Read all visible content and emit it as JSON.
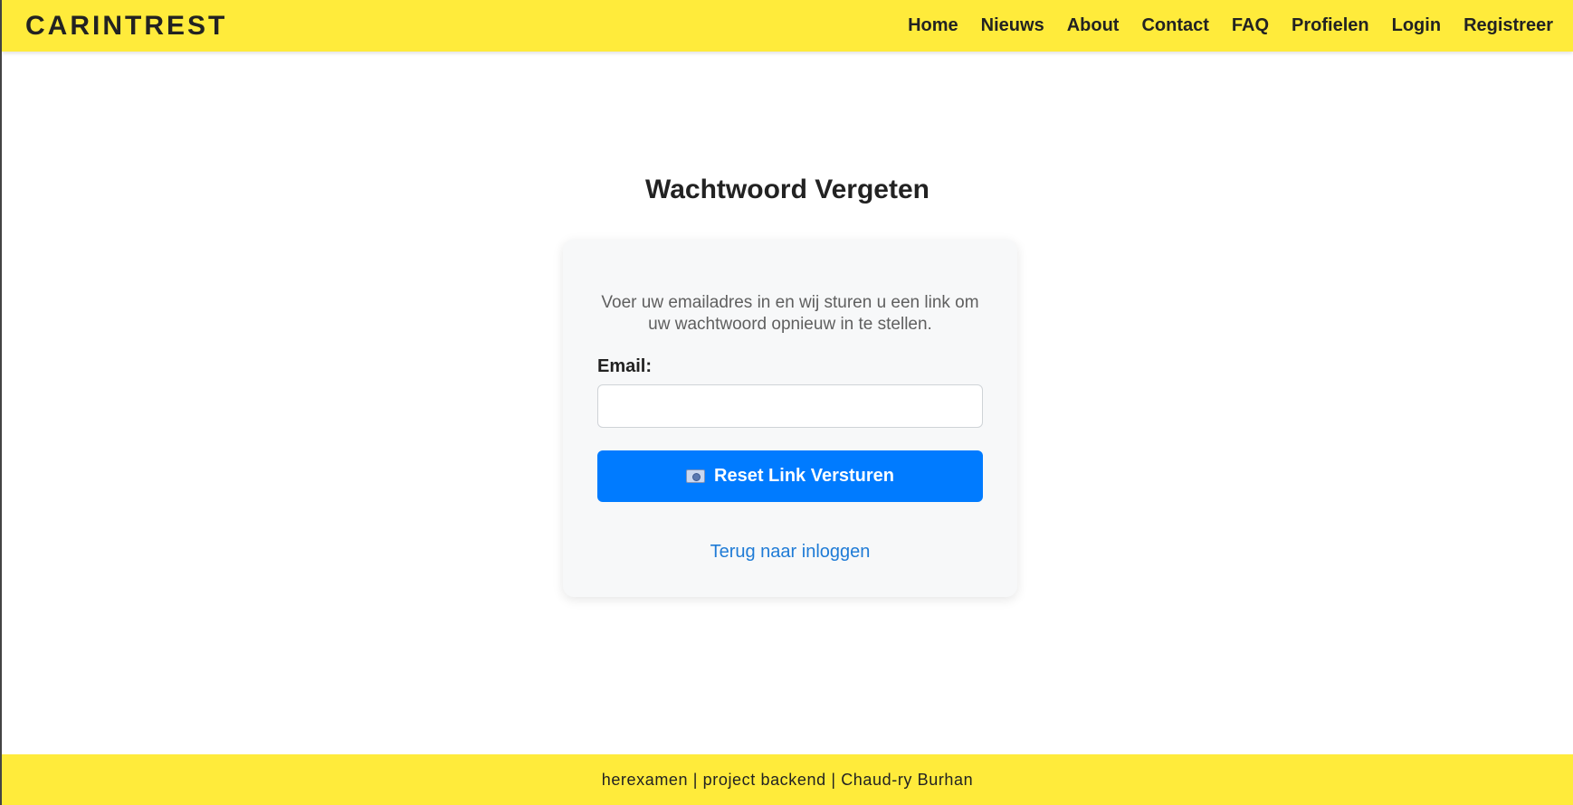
{
  "header": {
    "logo": "CARINTREST",
    "nav": [
      "Home",
      "Nieuws",
      "About",
      "Contact",
      "FAQ",
      "Profielen",
      "Login",
      "Registreer"
    ]
  },
  "main": {
    "title": "Wachtwoord Vergeten",
    "intro": "Voer uw emailadres in en wij sturen u een link om uw wachtwoord opnieuw in te stellen.",
    "email_label": "Email:",
    "email_value": "",
    "reset_button_label": "Reset Link Versturen",
    "reset_button_icon": "mail-icon",
    "back_link": "Terug naar inloggen"
  },
  "footer": {
    "text": "herexamen | project backend | Chaud-ry Burhan"
  },
  "colors": {
    "header_bg": "#ffeb3b",
    "footer_bg": "#ffeb3b",
    "button_bg": "#007bff",
    "link": "#1f7bd6",
    "card_bg": "#f7f8f9"
  }
}
